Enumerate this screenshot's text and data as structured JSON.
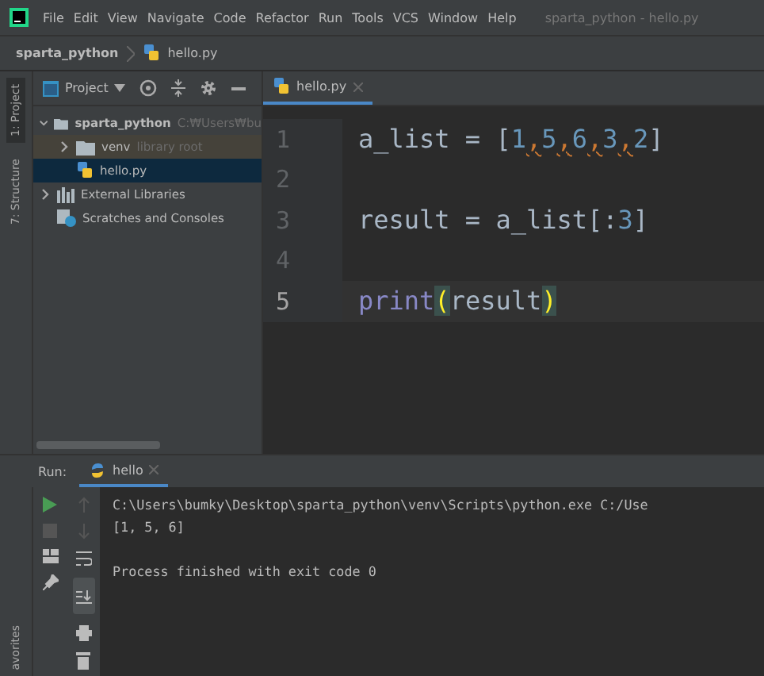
{
  "menu": [
    "File",
    "Edit",
    "View",
    "Navigate",
    "Code",
    "Refactor",
    "Run",
    "Tools",
    "VCS",
    "Window",
    "Help"
  ],
  "window": {
    "title": "sparta_python - hello.py"
  },
  "breadcrumb": {
    "project": "sparta_python",
    "file": "hello.py"
  },
  "left_strip": {
    "top": [
      "1: Project",
      "7: Structure"
    ],
    "bottom": "avorites"
  },
  "project_toolbar": {
    "title": "Project"
  },
  "tree": [
    {
      "label": "sparta_python",
      "hint": "C:₩Users₩bu",
      "kind": "folder",
      "expanded": true,
      "selected": false,
      "children": [
        {
          "label": "venv",
          "hint": "library root",
          "kind": "library-folder",
          "expanded": false,
          "selected": false
        },
        {
          "label": "hello.py",
          "kind": "python-file",
          "selected": true
        }
      ]
    },
    {
      "label": "External Libraries",
      "kind": "libraries",
      "expanded": false,
      "selected": false
    },
    {
      "label": "Scratches and Consoles",
      "kind": "scratches",
      "selected": false
    }
  ],
  "editor_tabs": [
    {
      "label": "hello.py",
      "selected": true
    }
  ],
  "code": [
    {
      "number": "1",
      "current": false,
      "tokens": [
        {
          "kind": "plain",
          "text": "a_list = ["
        },
        {
          "kind": "number",
          "text": "1"
        },
        {
          "kind": "warn",
          "text": ","
        },
        {
          "kind": "number",
          "text": "5"
        },
        {
          "kind": "warn",
          "text": ","
        },
        {
          "kind": "number",
          "text": "6"
        },
        {
          "kind": "warn",
          "text": ","
        },
        {
          "kind": "number",
          "text": "3"
        },
        {
          "kind": "warn",
          "text": ","
        },
        {
          "kind": "number",
          "text": "2"
        },
        {
          "kind": "plain",
          "text": "]"
        }
      ]
    },
    {
      "number": "2",
      "current": false
    },
    {
      "number": "3",
      "current": false,
      "tokens": [
        {
          "kind": "plain",
          "text": "result = a_list[:"
        },
        {
          "kind": "number",
          "text": "3"
        },
        {
          "kind": "plain",
          "text": "]"
        }
      ]
    },
    {
      "number": "4",
      "current": false
    },
    {
      "number": "5",
      "current": true,
      "tokens": [
        {
          "kind": "builtin",
          "text": "print"
        },
        {
          "kind": "brace",
          "text": "("
        },
        {
          "kind": "plain",
          "text": "result"
        },
        {
          "kind": "brace",
          "text": ")"
        }
      ]
    }
  ],
  "run_panel": {
    "label": "Run:",
    "tabs": [
      {
        "label": "hello",
        "selected": true
      }
    ],
    "console": [
      {
        "kind": "output",
        "text": "C:\\Users\\bumky\\Desktop\\sparta_python\\venv\\Scripts\\python.exe C:/Use"
      },
      {
        "kind": "output",
        "text": "[1, 5, 6]"
      },
      {
        "kind": "blank"
      },
      {
        "kind": "output",
        "text": "Process finished with exit code 0"
      }
    ],
    "scroll_to_end": true
  }
}
